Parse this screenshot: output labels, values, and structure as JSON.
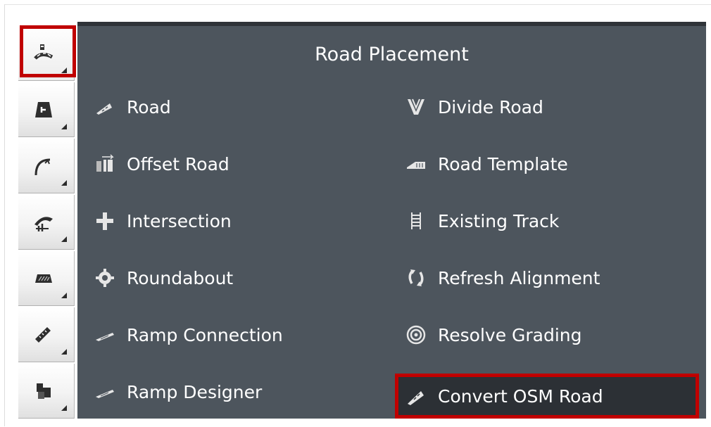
{
  "colors": {
    "panel_bg": "#4d555d",
    "highlight_border": "#c00000",
    "selected_item_bg": "#2c3035",
    "text": "#ffffff"
  },
  "sidebar": {
    "buttons": [
      {
        "icon": "road-placement-icon",
        "active": true
      },
      {
        "icon": "terrain-icon"
      },
      {
        "icon": "curve-icon"
      },
      {
        "icon": "intersection-tools-icon"
      },
      {
        "icon": "surface-icon"
      },
      {
        "icon": "measure-icon"
      },
      {
        "icon": "objects-icon"
      }
    ]
  },
  "panel": {
    "title": "Road Placement",
    "items": [
      {
        "label": "Road",
        "icon": "road-icon"
      },
      {
        "label": "Divide Road",
        "icon": "divide-road-icon"
      },
      {
        "label": "Offset Road",
        "icon": "offset-road-icon"
      },
      {
        "label": "Road Template",
        "icon": "road-template-icon"
      },
      {
        "label": "Intersection",
        "icon": "intersection-icon"
      },
      {
        "label": "Existing Track",
        "icon": "existing-track-icon"
      },
      {
        "label": "Roundabout",
        "icon": "roundabout-icon"
      },
      {
        "label": "Refresh Alignment",
        "icon": "refresh-alignment-icon"
      },
      {
        "label": "Ramp Connection",
        "icon": "ramp-connection-icon"
      },
      {
        "label": "Resolve Grading",
        "icon": "resolve-grading-icon"
      },
      {
        "label": "Ramp Designer",
        "icon": "ramp-designer-icon"
      },
      {
        "label": "Convert OSM Road",
        "icon": "convert-osm-road-icon",
        "highlighted": true
      }
    ]
  }
}
